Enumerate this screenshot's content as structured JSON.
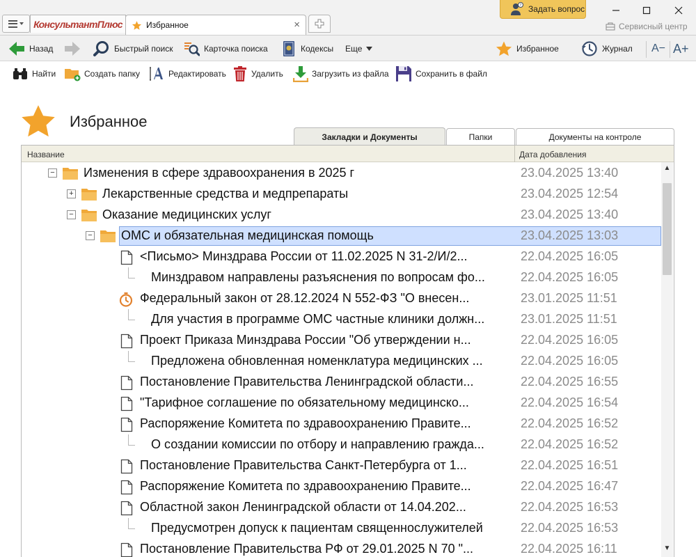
{
  "app": {
    "brand": "КонсультантПлюс",
    "tab_title": "Избранное",
    "ask_question": "Задать вопрос",
    "service_center": "Сервисный центр"
  },
  "toolbar1": {
    "back": "Назад",
    "quick_search": "Быстрый поиск",
    "search_card": "Карточка поиска",
    "codes": "Кодексы",
    "more": "Еще",
    "favorites": "Избранное",
    "journal": "Журнал",
    "font_smaller": "A−",
    "font_larger": "A+"
  },
  "toolbar2": {
    "find": "Найти",
    "create_folder": "Создать папку",
    "edit": "Редактировать",
    "delete": "Удалить",
    "load_from_file": "Загрузить из файла",
    "save_to_file": "Сохранить в файл"
  },
  "page": {
    "title": "Избранное"
  },
  "view_tabs": [
    {
      "label": "Закладки и Документы",
      "active": true
    },
    {
      "label": "Папки",
      "active": false
    },
    {
      "label": "Документы на контроле",
      "active": false
    }
  ],
  "columns": {
    "name": "Название",
    "date_added": "Дата добавления"
  },
  "tree": [
    {
      "level": 0,
      "type": "folder",
      "expander": "−",
      "label": "Изменения в сфере здравоохранения в 2025 г",
      "date": "23.04.2025 13:40"
    },
    {
      "level": 1,
      "type": "folder",
      "expander": "+",
      "label": "Лекарственные средства и медпрепараты",
      "date": "23.04.2025 12:54"
    },
    {
      "level": 1,
      "type": "folder",
      "expander": "−",
      "label": "Оказание медицинских услуг",
      "date": "23.04.2025 13:40"
    },
    {
      "level": 2,
      "type": "folder",
      "expander": "−",
      "label": "ОМС и обязательная медицинская помощь",
      "date": "23.04.2025 13:03",
      "selected": true
    },
    {
      "level": 3,
      "type": "document",
      "label": "<Письмо> Минздрава России от 11.02.2025 N 31-2/И/2...",
      "date": "22.04.2025 16:05"
    },
    {
      "level": 3,
      "type": "annotation",
      "label": "Минздравом направлены разъяснения по вопросам фо...",
      "date": "22.04.2025 16:05"
    },
    {
      "level": 3,
      "type": "timer",
      "label": "Федеральный закон от 28.12.2024 N 552-ФЗ \"О внесен...",
      "date": "23.01.2025 11:51"
    },
    {
      "level": 3,
      "type": "annotation",
      "label": "Для участия в программе ОМС частные клиники должн...",
      "date": "23.01.2025 11:51"
    },
    {
      "level": 3,
      "type": "document",
      "label": "Проект Приказа Минздрава России \"Об утверждении н...",
      "date": "22.04.2025 16:05"
    },
    {
      "level": 3,
      "type": "annotation",
      "label": "Предложена обновленная номенклатура медицинских ...",
      "date": "22.04.2025 16:05"
    },
    {
      "level": 3,
      "type": "document",
      "label": "Постановление Правительства Ленинградской области...",
      "date": "22.04.2025 16:55"
    },
    {
      "level": 3,
      "type": "document",
      "label": "\"Тарифное соглашение по обязательному медицинско...",
      "date": "22.04.2025 16:54"
    },
    {
      "level": 3,
      "type": "document",
      "label": "Распоряжение Комитета по здравоохранению Правите...",
      "date": "22.04.2025 16:52"
    },
    {
      "level": 3,
      "type": "annotation",
      "label": "О создании комиссии по отбору и направлению гражда...",
      "date": "22.04.2025 16:52"
    },
    {
      "level": 3,
      "type": "document",
      "label": "Постановление Правительства Санкт-Петербурга от 1...",
      "date": "22.04.2025 16:51"
    },
    {
      "level": 3,
      "type": "document",
      "label": "Распоряжение Комитета по здравоохранению Правите...",
      "date": "22.04.2025 16:47"
    },
    {
      "level": 3,
      "type": "document",
      "label": "Областной закон Ленинградской области от 14.04.202...",
      "date": "22.04.2025 16:53"
    },
    {
      "level": 3,
      "type": "annotation",
      "label": "Предусмотрен допуск к пациентам священнослужителей",
      "date": "22.04.2025 16:53"
    },
    {
      "level": 3,
      "type": "document",
      "label": "Постановление Правительства РФ от 29.01.2025 N 70 \"...",
      "date": "22.04.2025 16:11"
    }
  ],
  "colors": {
    "accent_star": "#f2a32c",
    "folder": "#f0a93a",
    "back_arrow": "#2e9b3a",
    "selection": "#cfe0ff",
    "date_text": "#8b8b8b"
  }
}
